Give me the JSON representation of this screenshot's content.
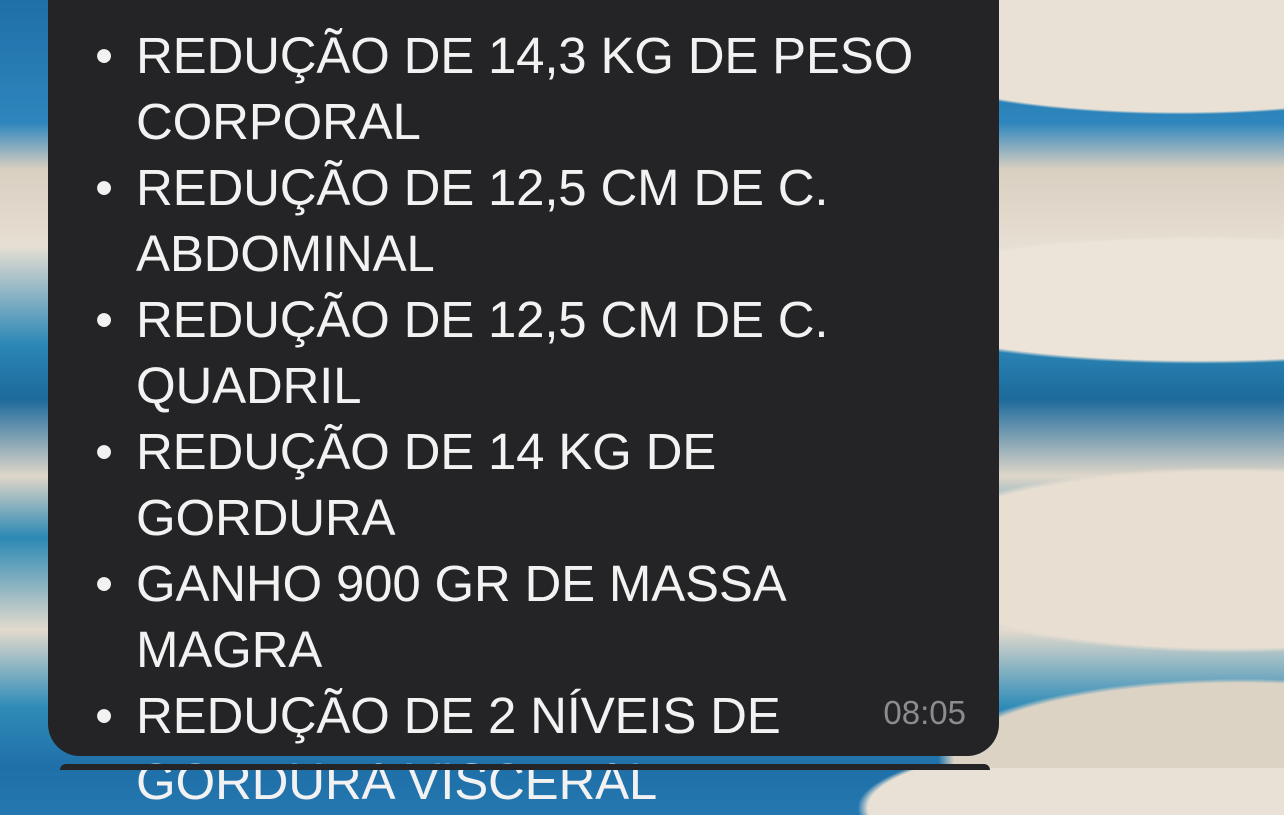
{
  "message": {
    "items": [
      "REDUÇÃO DE 14,3 KG DE PESO CORPORAL",
      "REDUÇÃO DE 12,5 CM DE C. ABDOMINAL",
      "REDUÇÃO DE 12,5 CM DE C. QUADRIL",
      "REDUÇÃO DE 14 KG DE GORDURA",
      "GANHO 900 GR DE MASSA MAGRA",
      "REDUÇÃO DE 2 NÍVEIS DE GORDURA VISCERAL"
    ],
    "bullet": "•",
    "timestamp": "08:05"
  },
  "theme": {
    "bubble_color": "#242426",
    "text_color": "#f2f2f2",
    "timestamp_color": "#8c8c90"
  }
}
